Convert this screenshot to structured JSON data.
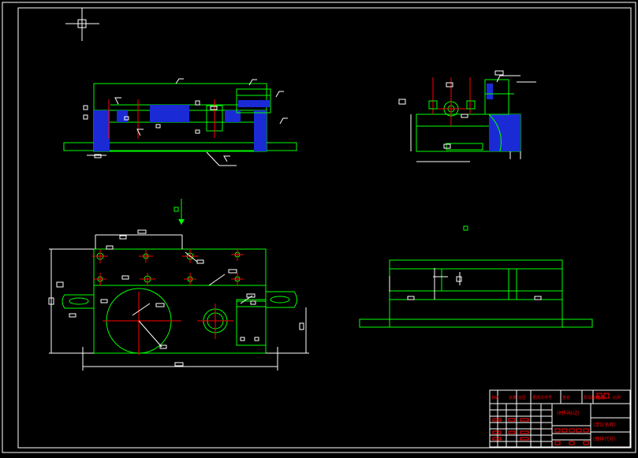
{
  "title_block": {
    "col_labels": [
      "标",
      "记",
      "处数",
      "分区",
      "更改文件号",
      "签名"
    ],
    "header_right": [
      "阶段标记",
      "重量",
      "比例"
    ],
    "material_label": "(材料标记)",
    "company_label": "(单位名称)",
    "drawing_name": "(图样名称)",
    "drawing_code": "(图样代号)"
  },
  "colors": {
    "background": "#000000",
    "outline": "#00ff00",
    "frame": "#ffffff",
    "centerline": "#ff0000",
    "hatch": "#0000ff",
    "dimension": "#ffffff",
    "accent": "#ffff00"
  }
}
